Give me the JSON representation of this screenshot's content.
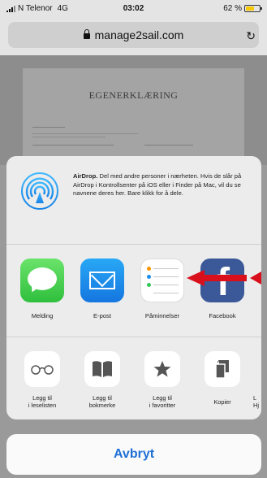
{
  "status_bar": {
    "carrier": "N Telenor",
    "network": "4G",
    "time": "03:02",
    "battery": "62 %",
    "battery_level": 0.62
  },
  "browser": {
    "url": "manage2sail.com"
  },
  "document": {
    "title": "EGENERKLÆRING"
  },
  "share_sheet": {
    "airdrop": {
      "title": "AirDrop.",
      "description": " Del med andre personer i nærheten. Hvis de slår på AirDrop i Kontrollsenter på iOS eller i Finder på Mac, vil du se navnene deres her. Bare klikk for å dele."
    },
    "apps": [
      {
        "label": "Melding",
        "icon": "messages-icon"
      },
      {
        "label": "E-post",
        "icon": "mail-icon"
      },
      {
        "label": "Påminnelser",
        "icon": "reminders-icon"
      },
      {
        "label": "Facebook",
        "icon": "facebook-icon"
      }
    ],
    "actions": [
      {
        "label": "Legg til\ni leselisten",
        "icon": "glasses-icon"
      },
      {
        "label": "Legg til\nbokmerke",
        "icon": "book-icon"
      },
      {
        "label": "Legg til\ni favoritter",
        "icon": "star-icon"
      },
      {
        "label": "Kopier",
        "icon": "copy-icon"
      },
      {
        "label": "L\nHj",
        "icon": "partial-action-icon"
      }
    ],
    "cancel_label": "Avbryt"
  },
  "colors": {
    "accent": "#1f6fd6",
    "arrow": "#d9101c",
    "facebook": "#3b5998",
    "messages": "#34c759",
    "mail": "#1d8cf0"
  }
}
